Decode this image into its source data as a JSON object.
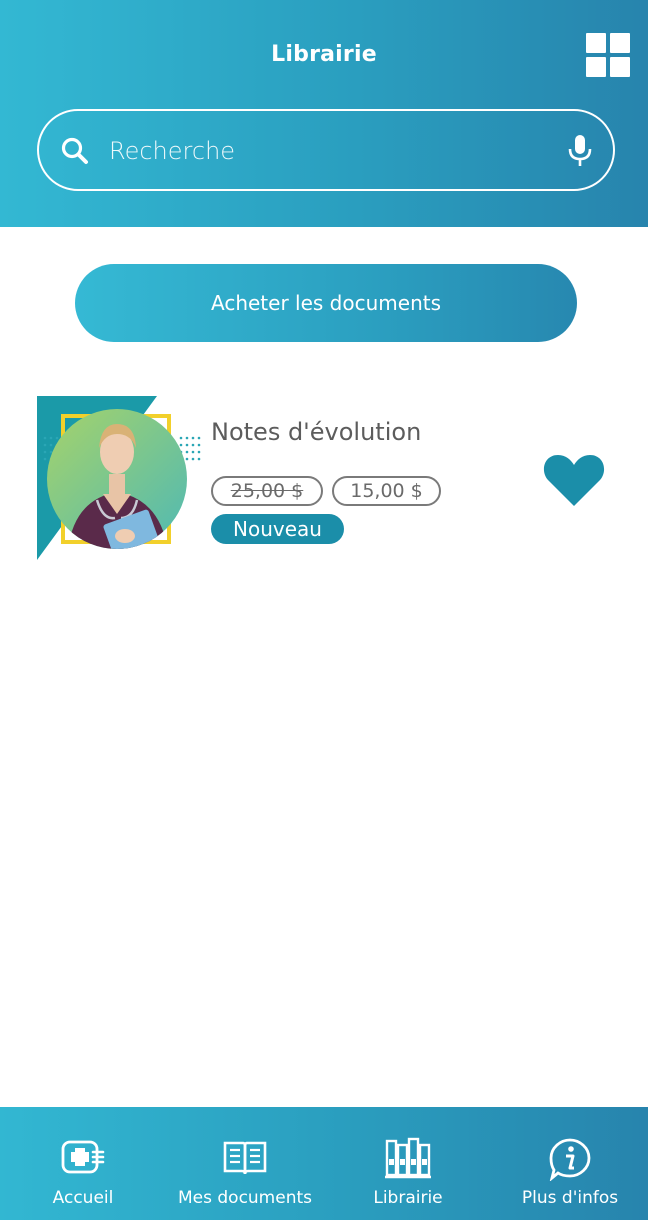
{
  "header": {
    "title": "Librairie",
    "grid_icon": "grid-icon"
  },
  "search": {
    "placeholder": "Recherche",
    "search_icon": "search-icon",
    "mic_icon": "microphone-icon"
  },
  "buy_button": {
    "label": "Acheter les documents"
  },
  "product": {
    "title": "Notes d'évolution",
    "old_price": "25,00 $",
    "new_price": "15,00 $",
    "badge": "Nouveau",
    "favorite_icon": "heart-icon"
  },
  "bottom_nav": [
    {
      "label": "Accueil",
      "icon": "medical-card-icon"
    },
    {
      "label": "Mes documents",
      "icon": "open-book-icon"
    },
    {
      "label": "Librairie",
      "icon": "bookshelf-icon"
    },
    {
      "label": "Plus d'infos",
      "icon": "info-bubble-icon"
    }
  ],
  "colors": {
    "header_start": "#33b8d3",
    "header_end": "#2784ad",
    "badge": "#1b8ea9",
    "heart": "#1b8ea9"
  }
}
